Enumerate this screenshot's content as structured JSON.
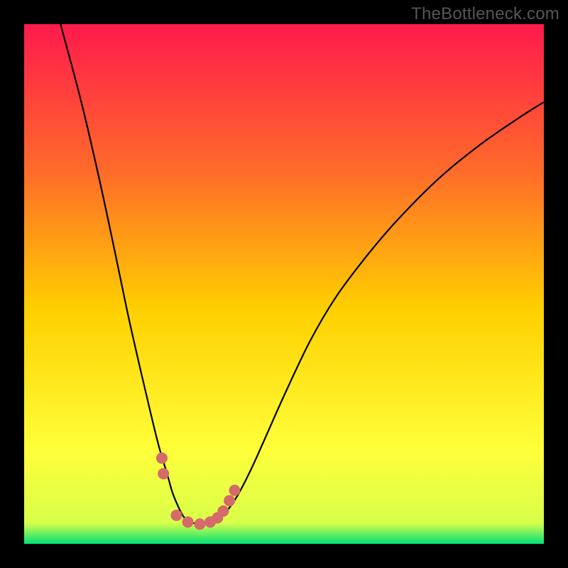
{
  "watermark": "TheBottleneck.com",
  "chart_data": {
    "type": "line",
    "title": "",
    "xlabel": "",
    "ylabel": "",
    "xlim": [
      0,
      1
    ],
    "ylim": [
      0,
      1
    ],
    "background_gradient": {
      "top": "#ff1a4d",
      "mid1": "#ff6a2a",
      "mid2": "#ffd000",
      "mid3": "#ffff3a",
      "bottom": "#00e076"
    },
    "series": [
      {
        "name": "bottleneck-curve",
        "stroke": "#000000",
        "stroke_width": 2.2,
        "x": [
          0.07,
          0.11,
          0.145,
          0.175,
          0.2,
          0.225,
          0.245,
          0.26,
          0.275,
          0.285,
          0.295,
          0.305,
          0.315,
          0.335,
          0.355,
          0.385,
          0.41,
          0.435,
          0.46,
          0.5,
          0.55,
          0.6,
          0.66,
          0.72,
          0.8,
          0.88,
          0.96,
          1.0
        ],
        "values": [
          1.0,
          0.85,
          0.7,
          0.56,
          0.44,
          0.33,
          0.245,
          0.185,
          0.135,
          0.1,
          0.075,
          0.055,
          0.045,
          0.038,
          0.04,
          0.058,
          0.092,
          0.14,
          0.195,
          0.285,
          0.39,
          0.475,
          0.555,
          0.625,
          0.705,
          0.77,
          0.825,
          0.85
        ]
      }
    ],
    "markers": {
      "name": "highlight-dots",
      "fill": "#d46a6a",
      "radius": 8,
      "x": [
        0.265,
        0.268,
        0.293,
        0.315,
        0.338,
        0.358,
        0.372,
        0.383,
        0.395,
        0.405
      ],
      "values": [
        0.165,
        0.135,
        0.055,
        0.042,
        0.038,
        0.042,
        0.05,
        0.063,
        0.083,
        0.103
      ]
    }
  }
}
